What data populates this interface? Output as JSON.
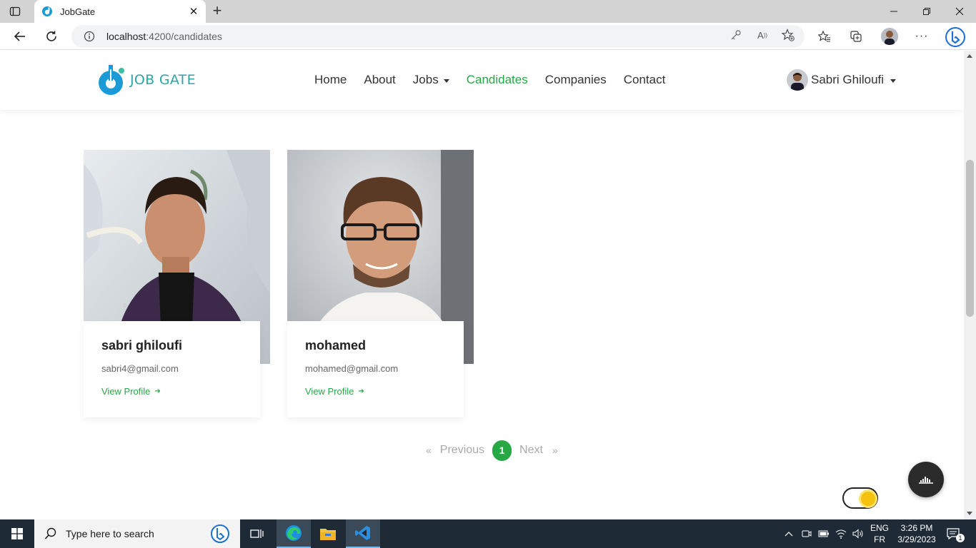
{
  "browser": {
    "tab_title": "JobGate",
    "url_host": "localhost",
    "url_path": ":4200/candidates"
  },
  "site": {
    "logo_text": "JOB GATE",
    "nav": [
      {
        "label": "Home"
      },
      {
        "label": "About"
      },
      {
        "label": "Jobs"
      },
      {
        "label": "Candidates"
      },
      {
        "label": "Companies"
      },
      {
        "label": "Contact"
      }
    ],
    "active_nav": "Candidates",
    "user_name": "Sabri Ghiloufi"
  },
  "candidates": [
    {
      "name": "sabri ghiloufi",
      "email": "sabri4@gmail.com",
      "link_label": "View Profile"
    },
    {
      "name": "mohamed",
      "email": "mohamed@gmail.com",
      "link_label": "View Profile"
    }
  ],
  "pagination": {
    "first": "«",
    "previous": "Previous",
    "current": "1",
    "next": "Next",
    "last": "»"
  },
  "taskbar": {
    "search_placeholder": "Type here to search",
    "lang_top": "ENG",
    "lang_bottom": "FR",
    "time": "3:26 PM",
    "date": "3/29/2023",
    "notification_count": "1"
  },
  "colors": {
    "accent": "#28a745",
    "logo": "#2da6a3",
    "taskbar": "#1e2b36"
  },
  "icons": [
    "tab-actions-icon",
    "edge-favicon-icon",
    "close-icon",
    "plus-icon",
    "minimize-icon",
    "restore-icon",
    "back-icon",
    "refresh-icon",
    "info-icon",
    "key-icon",
    "read-aloud-icon",
    "add-favorite-icon",
    "favorites-icon",
    "collections-icon",
    "more-icon",
    "bing-icon",
    "caret-down-icon",
    "arrow-right-icon",
    "chat-icon",
    "sun-icon",
    "windows-icon",
    "search-icon",
    "task-view-icon",
    "edge-icon",
    "file-explorer-icon",
    "vscode-icon",
    "chevron-up-icon",
    "meet-icon",
    "battery-icon",
    "wifi-icon",
    "volume-icon",
    "notification-icon"
  ]
}
